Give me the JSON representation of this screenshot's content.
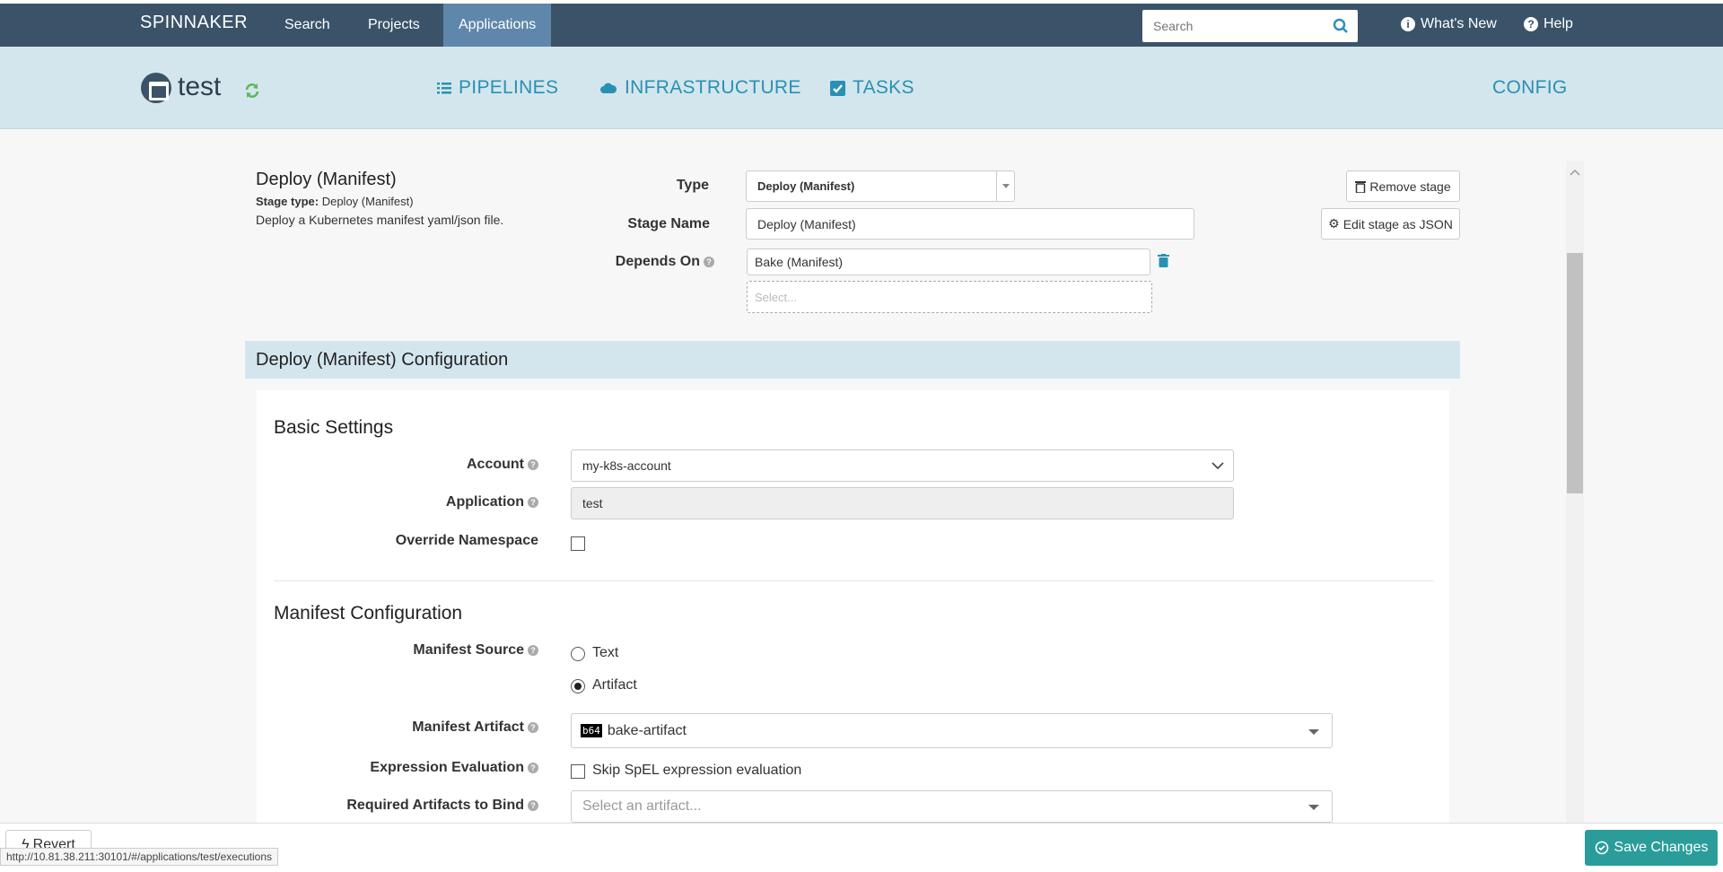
{
  "topnav": {
    "brand": "SPINNAKER",
    "links": [
      "Search",
      "Projects",
      "Applications"
    ],
    "search_placeholder": "Search",
    "whats_new": "What's New",
    "help": "Help"
  },
  "app": {
    "name": "test",
    "tabs": {
      "pipelines": "PIPELINES",
      "infrastructure": "INFRASTRUCTURE",
      "tasks": "TASKS",
      "config": "CONFIG"
    }
  },
  "stage": {
    "title": "Deploy (Manifest)",
    "type_label": "Stage type:",
    "type_value": "Deploy (Manifest)",
    "description": "Deploy a Kubernetes manifest yaml/json file.",
    "fields": {
      "type_label": "Type",
      "type_value": "Deploy (Manifest)",
      "name_label": "Stage Name",
      "name_value": "Deploy (Manifest)",
      "depends_label": "Depends On",
      "depends_value": "Bake (Manifest)",
      "depends_placeholder": "Select..."
    },
    "buttons": {
      "remove": "Remove stage",
      "edit_json": "Edit stage as JSON"
    }
  },
  "config": {
    "header": "Deploy (Manifest) Configuration",
    "basic": {
      "title": "Basic Settings",
      "account_label": "Account",
      "account_value": "my-k8s-account",
      "application_label": "Application",
      "application_value": "test",
      "override_label": "Override Namespace"
    },
    "manifest": {
      "title": "Manifest Configuration",
      "source_label": "Manifest Source",
      "source_options": [
        "Text",
        "Artifact"
      ],
      "source_selected": "Artifact",
      "artifact_label": "Manifest Artifact",
      "artifact_badge": "b64",
      "artifact_value": "bake-artifact",
      "expr_label": "Expression Evaluation",
      "expr_option": "Skip SpEL expression evaluation",
      "required_label": "Required Artifacts to Bind",
      "required_placeholder": "Select an artifact..."
    }
  },
  "footer": {
    "revert": "Revert",
    "save": "Save Changes",
    "status_url": "http://10.81.38.211:30101/#/applications/test/executions"
  },
  "colors": {
    "nav": "#3b5369",
    "appbar": "#d4e6ed",
    "accent": "#2891b3",
    "save": "#2a9d9a"
  }
}
